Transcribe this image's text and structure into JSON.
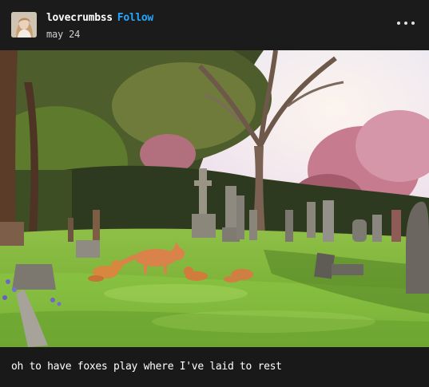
{
  "post": {
    "username": "lovecrumbss",
    "follow_label": "Follow",
    "date": "may 24",
    "caption": "oh to have foxes play where I've laid to rest"
  },
  "icons": {
    "avatar": "avatar-portrait",
    "more": "more-options-icon"
  },
  "colors": {
    "background": "#1a1a1b",
    "follow": "#26a7ff",
    "text": "#ffffff"
  }
}
